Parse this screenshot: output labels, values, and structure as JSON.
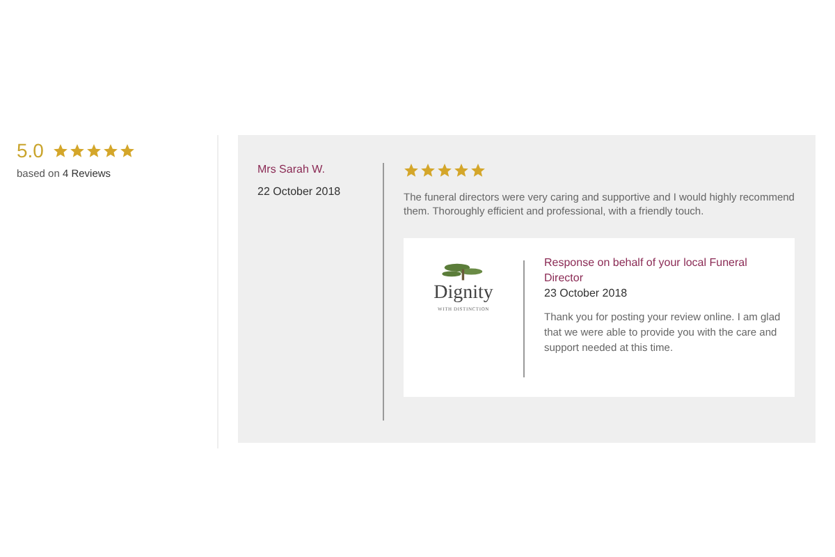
{
  "summary": {
    "score": "5.0",
    "stars": 5,
    "based_on": "based on **4 Reviews**"
  },
  "review": {
    "author": "Mrs Sarah W.",
    "date": "22 October 2018",
    "stars": 5,
    "text": "The funeral directors were very caring and supportive and I would highly recommend them. Thoroughly efficient and professional, with a friendly touch.",
    "response": {
      "logo_name": "Dignity",
      "logo_tagline": "WITH DISTINCTION",
      "title": "Response on behalf of your local Funeral Director",
      "date": "23 October 2018",
      "text": "Thank you for posting your review online. I am glad that we were able to provide you with the care and support needed at this time."
    }
  }
}
